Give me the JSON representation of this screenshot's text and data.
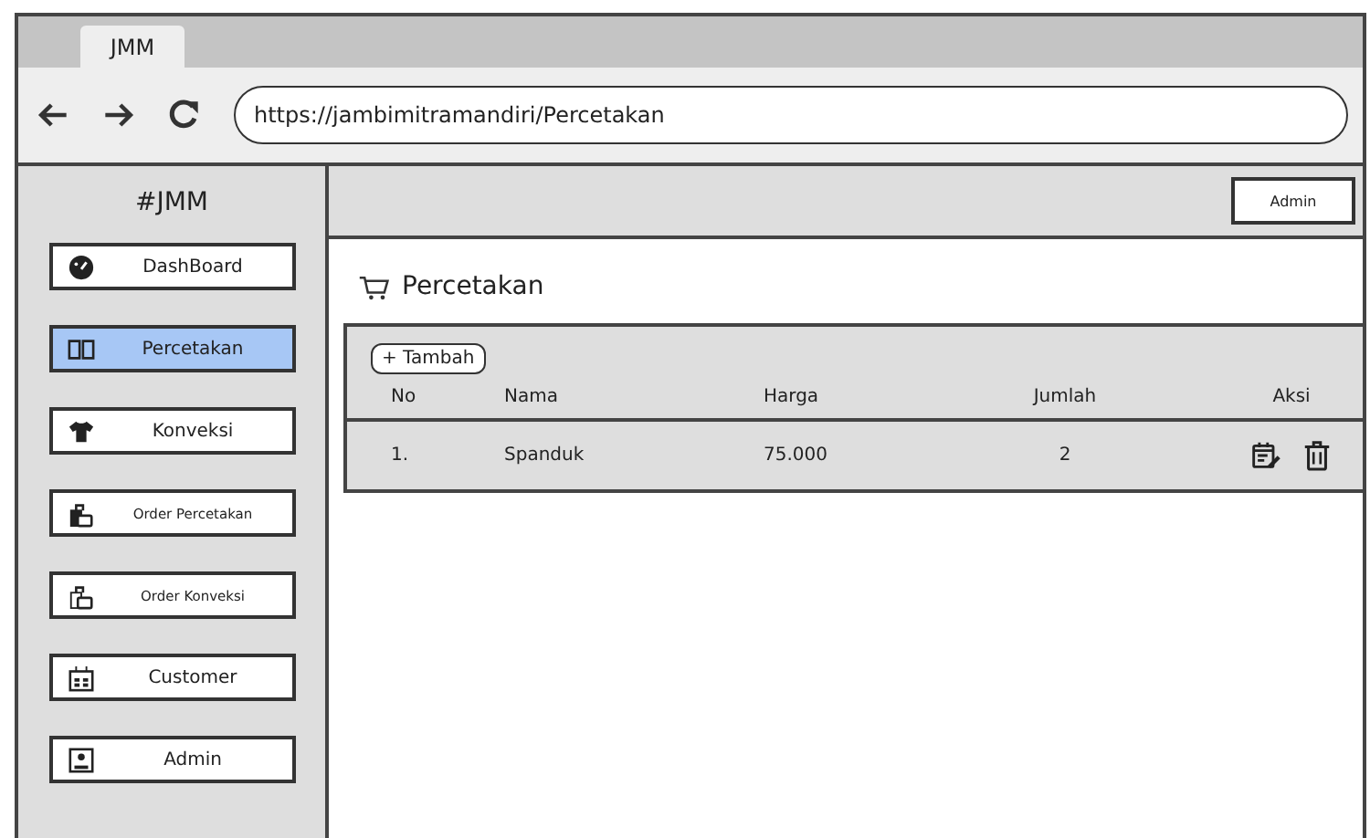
{
  "browser": {
    "tab": "JMM",
    "url": "https://jambimitramandiri/Percetakan"
  },
  "sidebar": {
    "title": "#JMM",
    "items": [
      {
        "label": "DashBoard",
        "selected": false,
        "kind": "regular"
      },
      {
        "label": "Percetakan",
        "selected": true,
        "kind": "regular"
      },
      {
        "label": "Konveksi",
        "selected": false,
        "kind": "regular"
      },
      {
        "label": "Order Percetakan",
        "selected": false,
        "kind": "compact"
      },
      {
        "label": "Order Konveksi",
        "selected": false,
        "kind": "compact"
      },
      {
        "label": "Customer",
        "selected": false,
        "kind": "regular"
      },
      {
        "label": "Admin",
        "selected": false,
        "kind": "regular"
      }
    ]
  },
  "topbar": {
    "user_button": "Admin"
  },
  "page": {
    "title": "Percetakan",
    "add_button": "+ Tambah",
    "table": {
      "columns": [
        "No",
        "Nama",
        "Harga",
        "Jumlah",
        "Aksi"
      ],
      "rows": [
        {
          "no": "1.",
          "nama": "Spanduk",
          "harga": "75.000",
          "jumlah": "2"
        }
      ]
    }
  }
}
